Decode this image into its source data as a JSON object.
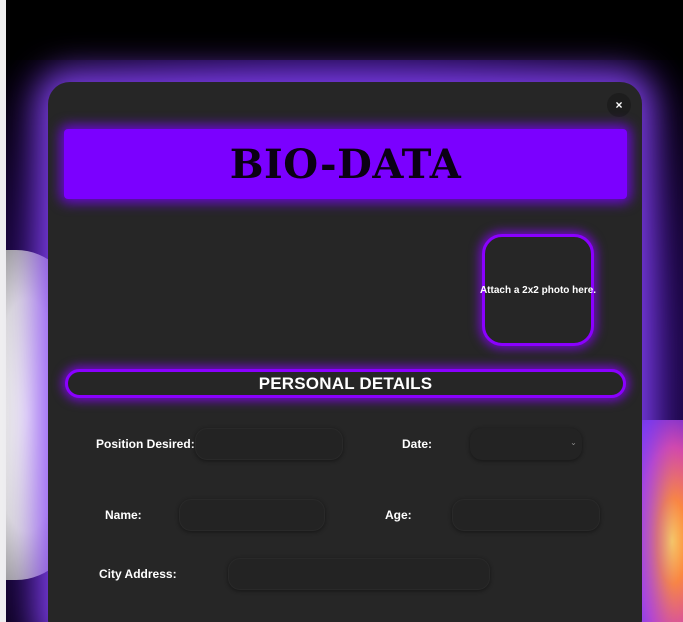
{
  "modal": {
    "close_label": "×",
    "title": "BIO-DATA",
    "photo_placeholder": "Attach a 2x2 photo here.",
    "section_title": "PERSONAL DETAILS"
  },
  "form": {
    "position_label": "Position Desired:",
    "position_value": "",
    "date_label": "Date:",
    "date_value": "",
    "name_label": "Name:",
    "name_value": "",
    "age_label": "Age:",
    "age_value": "",
    "city_label": "City Address:",
    "city_value": ""
  },
  "icons": {
    "close": "close-icon",
    "chevron": "chevron-down-icon"
  },
  "colors": {
    "accent": "#7b00ff",
    "modal_bg": "#262626",
    "glow": "#8c46ff"
  }
}
